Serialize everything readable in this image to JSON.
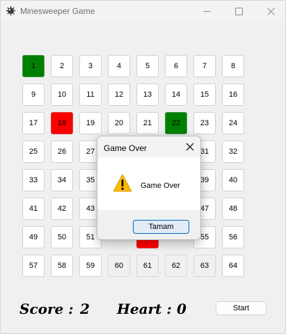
{
  "window": {
    "title": "Minesweeper Game"
  },
  "board": {
    "cells": [
      {
        "label": "1",
        "state": "green"
      },
      {
        "label": "2",
        "state": "normal"
      },
      {
        "label": "3",
        "state": "normal"
      },
      {
        "label": "4",
        "state": "normal"
      },
      {
        "label": "5",
        "state": "normal"
      },
      {
        "label": "6",
        "state": "normal"
      },
      {
        "label": "7",
        "state": "normal"
      },
      {
        "label": "8",
        "state": "normal"
      },
      {
        "label": "9",
        "state": "normal"
      },
      {
        "label": "10",
        "state": "normal"
      },
      {
        "label": "11",
        "state": "normal"
      },
      {
        "label": "12",
        "state": "normal"
      },
      {
        "label": "13",
        "state": "normal"
      },
      {
        "label": "14",
        "state": "normal"
      },
      {
        "label": "15",
        "state": "normal"
      },
      {
        "label": "16",
        "state": "normal"
      },
      {
        "label": "17",
        "state": "normal"
      },
      {
        "label": "18",
        "state": "red"
      },
      {
        "label": "19",
        "state": "normal"
      },
      {
        "label": "20",
        "state": "normal"
      },
      {
        "label": "21",
        "state": "normal"
      },
      {
        "label": "22",
        "state": "green"
      },
      {
        "label": "23",
        "state": "normal"
      },
      {
        "label": "24",
        "state": "normal"
      },
      {
        "label": "25",
        "state": "normal"
      },
      {
        "label": "26",
        "state": "normal"
      },
      {
        "label": "27",
        "state": "normal"
      },
      {
        "label": "",
        "state": "hidden"
      },
      {
        "label": "",
        "state": "hidden"
      },
      {
        "label": "",
        "state": "hidden"
      },
      {
        "label": "31",
        "state": "normal"
      },
      {
        "label": "32",
        "state": "normal"
      },
      {
        "label": "33",
        "state": "normal"
      },
      {
        "label": "34",
        "state": "normal"
      },
      {
        "label": "35",
        "state": "normal"
      },
      {
        "label": "",
        "state": "hidden"
      },
      {
        "label": "",
        "state": "hidden"
      },
      {
        "label": "",
        "state": "hidden"
      },
      {
        "label": "39",
        "state": "normal"
      },
      {
        "label": "40",
        "state": "normal"
      },
      {
        "label": "41",
        "state": "normal"
      },
      {
        "label": "42",
        "state": "normal"
      },
      {
        "label": "43",
        "state": "normal"
      },
      {
        "label": "",
        "state": "hidden"
      },
      {
        "label": "",
        "state": "hidden"
      },
      {
        "label": "",
        "state": "hidden"
      },
      {
        "label": "47",
        "state": "normal"
      },
      {
        "label": "48",
        "state": "normal"
      },
      {
        "label": "49",
        "state": "normal"
      },
      {
        "label": "50",
        "state": "normal"
      },
      {
        "label": "51",
        "state": "normal"
      },
      {
        "label": "",
        "state": "hidden"
      },
      {
        "label": "",
        "state": "red"
      },
      {
        "label": "",
        "state": "hidden"
      },
      {
        "label": "55",
        "state": "normal"
      },
      {
        "label": "56",
        "state": "normal"
      },
      {
        "label": "57",
        "state": "normal"
      },
      {
        "label": "58",
        "state": "normal"
      },
      {
        "label": "59",
        "state": "normal"
      },
      {
        "label": "60",
        "state": "grey"
      },
      {
        "label": "61",
        "state": "grey"
      },
      {
        "label": "62",
        "state": "grey"
      },
      {
        "label": "63",
        "state": "grey"
      },
      {
        "label": "64",
        "state": "normal"
      }
    ]
  },
  "status": {
    "score_label": "Score :",
    "score_value": "2",
    "heart_label": "Heart :",
    "heart_value": "0",
    "start_label": "Start"
  },
  "dialog": {
    "title": "Game Over",
    "message": "Game Over",
    "ok_label": "Tamam",
    "icon": "warning-icon"
  },
  "colors": {
    "safe_cell": "#008000",
    "mine_cell": "#ff0000",
    "accent": "#0067c0"
  }
}
